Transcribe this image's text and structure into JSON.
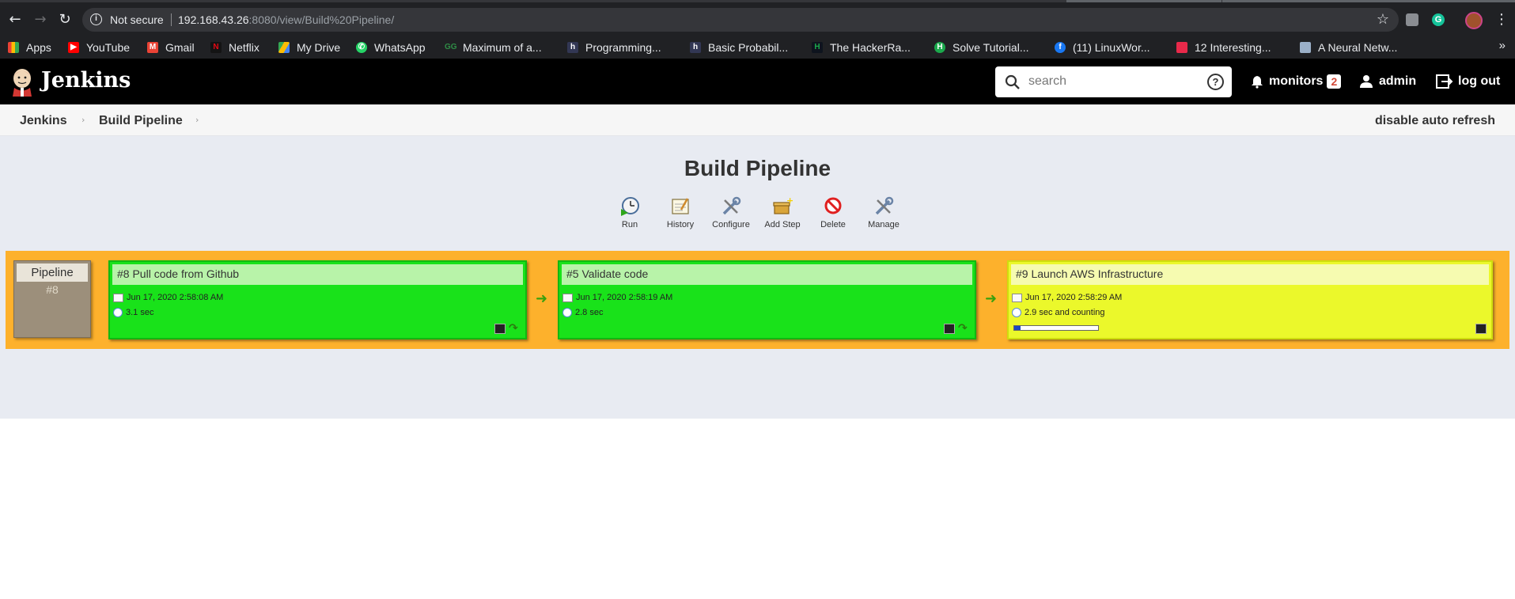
{
  "browser": {
    "security_label": "Not secure",
    "url_host": "192.168.43.26",
    "url_rest": ":8080/view/Build%20Pipeline/",
    "bookmarks": [
      {
        "label": "Apps",
        "icon": "apps-grid-icon",
        "color": "#ea4335"
      },
      {
        "label": "YouTube",
        "icon": "youtube-icon",
        "color": "#ff0000"
      },
      {
        "label": "Gmail",
        "icon": "gmail-icon",
        "color": "#ea4335"
      },
      {
        "label": "Netflix",
        "icon": "netflix-icon",
        "color": "#e50914"
      },
      {
        "label": "My Drive",
        "icon": "drive-icon",
        "color": "#fbbc04"
      },
      {
        "label": "WhatsApp",
        "icon": "whatsapp-icon",
        "color": "#25d366"
      },
      {
        "label": "Maximum of a...",
        "icon": "geeksforgeeks-icon",
        "color": "#2f8d46"
      },
      {
        "label": "Programming...",
        "icon": "hackerearth-icon",
        "color": "#323754"
      },
      {
        "label": "Basic Probabil...",
        "icon": "hackerearth-icon",
        "color": "#323754"
      },
      {
        "label": "The HackerRa...",
        "icon": "hackerrank-icon",
        "color": "#1ba94c"
      },
      {
        "label": "Solve Tutorial...",
        "icon": "hackerrank-icon",
        "color": "#1ba94c"
      },
      {
        "label": "(11) LinuxWor...",
        "icon": "facebook-icon",
        "color": "#1877f2"
      },
      {
        "label": "12 Interesting...",
        "icon": "bookmark-site-icon",
        "color": "#e8294a"
      },
      {
        "label": "A Neural Netw...",
        "icon": "bookmark-site-icon",
        "color": "#9bb0c8"
      }
    ]
  },
  "header": {
    "app_title": "Jenkins",
    "search_placeholder": "search",
    "monitors_label": "monitors",
    "monitors_count": "2",
    "user_label": "admin",
    "logout_label": "log out"
  },
  "breadcrumb": {
    "items": [
      "Jenkins",
      "Build Pipeline"
    ],
    "auto_refresh_label": "disable auto refresh"
  },
  "page": {
    "title": "Build Pipeline",
    "toolbar": [
      "Run",
      "History",
      "Configure",
      "Add Step",
      "Delete",
      "Manage"
    ]
  },
  "pipeline": {
    "trigger_label": "Pipeline",
    "trigger_number": "#8",
    "builds": [
      {
        "title": "#8 Pull code from Github",
        "date": "Jun 17, 2020 2:58:08 AM",
        "duration": "3.1 sec",
        "status": "success",
        "color": "#19e21a"
      },
      {
        "title": "#5 Validate code",
        "date": "Jun 17, 2020 2:58:19 AM",
        "duration": "2.8 sec",
        "status": "success",
        "color": "#19e21a"
      },
      {
        "title": "#9 Launch AWS Infrastructure",
        "date": "Jun 17, 2020 2:58:29 AM",
        "duration": "2.9 sec and counting",
        "status": "running",
        "color": "#ebf82b",
        "progress_fraction": 0.08
      }
    ]
  }
}
